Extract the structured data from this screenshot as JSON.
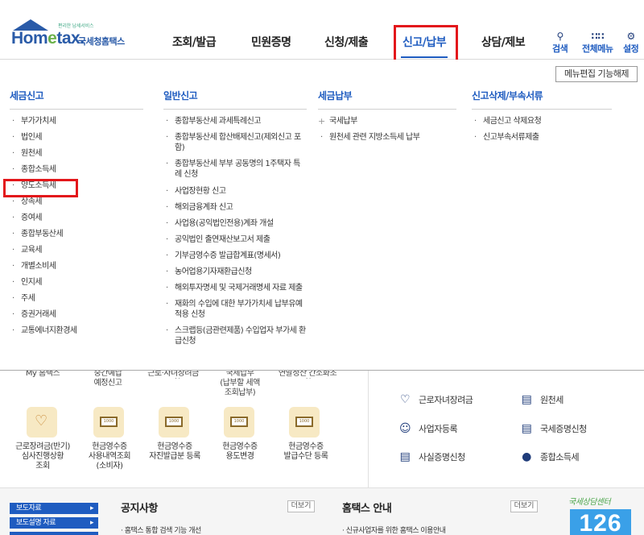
{
  "header": {
    "logo_tagline": "편리한 납세서비스",
    "logo_brand_pre": "Hom",
    "logo_brand_e": "e",
    "logo_brand_post": "tax.",
    "logo_brand_kr": "국세청홈택스",
    "nav": [
      "조회/발급",
      "민원증명",
      "신청/제출",
      "신고/납부",
      "상담/제보"
    ],
    "active_nav": "신고/납부",
    "utils": [
      {
        "label": "검색",
        "icon": "search-icon"
      },
      {
        "label": "전체메뉴",
        "icon": "grid-icon"
      },
      {
        "label": "설정",
        "icon": "gear-icon"
      }
    ]
  },
  "mega": {
    "edit_button": "메뉴편집 기능해제",
    "columns": [
      {
        "title": "세금신고",
        "items": [
          "부가가치세",
          "법인세",
          "원천세",
          "종합소득세",
          "양도소득세",
          "상속세",
          "증여세",
          "종합부동산세",
          "교육세",
          "개별소비세",
          "인지세",
          "주세",
          "증권거래세",
          "교통에너지환경세"
        ]
      },
      {
        "title": "일반신고",
        "items": [
          "종합부동산세 과세특례신고",
          "종합부동산세 합산배제신고(제외신고 포함)",
          "종합부동산세 부부 공동명의 1주택자 특례 신청",
          "사업장현황 신고",
          "해외금융계좌 신고",
          "사업용(공익법인전용)계좌 개설",
          "공익법인 출연재산보고서 제출",
          "기부금영수증 발급합계표(명세서)",
          "농어업용기자재환급신청",
          "해외투자명세 및 국제거래명세 자료 제출",
          "재화의 수입에 대한 부가가치세 납부유예 적용 신청",
          "스크랩등(금관련제품) 수입업자 부가세 환급신청"
        ]
      },
      {
        "title": "세금납부",
        "items": [
          "국세납부",
          "원천세 관련 지방소득세 납부"
        ]
      },
      {
        "title": "신고삭제/부속서류",
        "items": [
          "세금신고 삭제요청",
          "신고부속서류제출"
        ]
      }
    ]
  },
  "lower": {
    "partial_labels": [
      "My 홈택스",
      "중간예납\n예정신고",
      "근로·자녀장려금조회",
      "국세납부\n(납부할 세액\n조회납부)",
      "연말정산 간소화조회"
    ],
    "quick_items": [
      {
        "label": "근로장려금(반기)\n심사진행상황\n조회",
        "icon": "heart-icon"
      },
      {
        "label": "현금영수증\n사용내역조회\n(소비자)",
        "icon": "receipt-search-icon"
      },
      {
        "label": "현금영수증\n자진발급분 등록",
        "icon": "receipt-search-icon"
      },
      {
        "label": "현금영수증\n용도변경",
        "icon": "receipt-search-icon"
      },
      {
        "label": "현금영수증\n발급수단 등록",
        "icon": "receipt-search-icon"
      }
    ],
    "right_items": [
      {
        "label": "근로자녀장려금",
        "icon": "heart-hand-icon"
      },
      {
        "label": "원천세",
        "icon": "tax-slip-icon"
      },
      {
        "label": "사업자등록",
        "icon": "person-icon"
      },
      {
        "label": "국세증명신청",
        "icon": "document-icon"
      },
      {
        "label": "사실증명신청",
        "icon": "document-icon"
      },
      {
        "label": "종합소득세",
        "icon": "money-bag-icon"
      }
    ]
  },
  "bottom": {
    "pills": [
      "보도자료",
      "보도설명 자료"
    ],
    "notice_title": "공지사항",
    "notice_more": "더보기",
    "notice_item": "홈택스 통합 검색 기능 개선",
    "guide_title": "홈택스 안내",
    "guide_more": "더보기",
    "guide_item": "신규사업자를 위한 홈택스 이용안내",
    "center_title": "국세상담센터",
    "center_number": "126"
  }
}
